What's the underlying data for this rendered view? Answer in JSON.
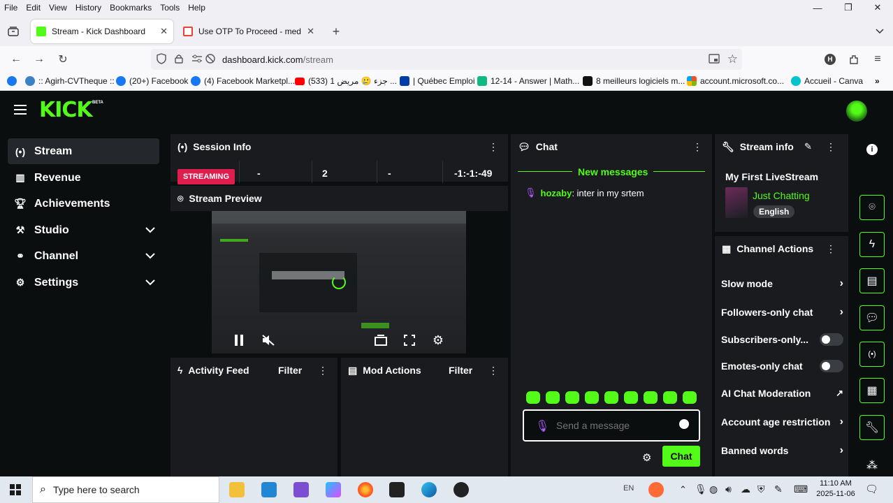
{
  "browser": {
    "menu": [
      "File",
      "Edit",
      "View",
      "History",
      "Bookmarks",
      "Tools",
      "Help"
    ],
    "window_controls": {
      "minimize": "—",
      "restore": "❐",
      "close": "✕"
    },
    "tabs": [
      {
        "title": "Stream - Kick Dashboard",
        "active": true,
        "favicon_color": "#53fc18"
      },
      {
        "title": "Use OTP To Proceed - medhbas",
        "active": false,
        "favicon_color": "#ea4335"
      }
    ],
    "new_tab": "+",
    "url_domain": "dashboard.kick.com",
    "url_path": "/stream",
    "bookmarks": [
      {
        "label": "",
        "color": "#1877f2"
      },
      {
        "label": ":: Agirh-CVTheque ::",
        "color": "#3b82c4"
      },
      {
        "label": "(20+) Facebook",
        "color": "#1877f2"
      },
      {
        "label": "(4) Facebook Marketpl...",
        "color": "#1877f2"
      },
      {
        "label": "(533) 1 جزء 🥲 مريض ...",
        "color": "#ff0000"
      },
      {
        "label": "| Québec Emploi",
        "color": "#003da5"
      },
      {
        "label": "12-14 - Answer | Math...",
        "color": "#10b981"
      },
      {
        "label": "8 meilleurs logiciels m...",
        "color": "#111111"
      },
      {
        "label": "account.microsoft.co...",
        "color": "#f25022"
      },
      {
        "label": "Accueil - Canva",
        "color": "#00c4cc"
      }
    ]
  },
  "kick": {
    "logo": "KICK",
    "beta": "BETA",
    "accent": "#53fc18",
    "sidebar": [
      {
        "label": "Stream",
        "icon": "broadcast-icon",
        "active": true,
        "chevron": false
      },
      {
        "label": "Revenue",
        "icon": "chart-icon",
        "active": false,
        "chevron": false
      },
      {
        "label": "Achievements",
        "icon": "trophy-icon",
        "active": false,
        "chevron": false
      },
      {
        "label": "Studio",
        "icon": "studio-icon",
        "active": false,
        "chevron": true
      },
      {
        "label": "Channel",
        "icon": "channel-icon",
        "active": false,
        "chevron": true
      },
      {
        "label": "Settings",
        "icon": "gear-icon",
        "active": false,
        "chevron": true
      }
    ],
    "session": {
      "title": "Session Info",
      "status": "STREAMING",
      "cells": [
        "-",
        "2",
        "-",
        "-1:-1:-49"
      ]
    },
    "preview": {
      "title": "Stream Preview"
    },
    "activity": {
      "title": "Activity Feed",
      "filter": "Filter"
    },
    "mod": {
      "title": "Mod Actions",
      "filter": "Filter"
    },
    "chat": {
      "title": "Chat",
      "new_messages": "New messages",
      "messages": [
        {
          "user": "hozaby",
          "text": ": inter in my srtem"
        }
      ],
      "placeholder": "Send a message",
      "send": "Chat"
    },
    "stream_info": {
      "title": "Stream info",
      "stream_title": "My First LiveStream",
      "category": "Just Chatting",
      "language": "English"
    },
    "channel_actions": {
      "title": "Channel Actions",
      "items": [
        {
          "label": "Slow mode",
          "control": "arrow"
        },
        {
          "label": "Followers-only chat",
          "control": "arrow"
        },
        {
          "label": "Subscribers-only...",
          "control": "toggle"
        },
        {
          "label": "Emotes-only chat",
          "control": "toggle"
        },
        {
          "label": "AI Chat Moderation",
          "control": "external"
        },
        {
          "label": "Account age restriction",
          "control": "arrow"
        },
        {
          "label": "Banned words",
          "control": "arrow"
        }
      ]
    }
  },
  "taskbar": {
    "search_placeholder": "Type here to search",
    "time": "11:10 AM",
    "date": "2025-11-06",
    "lang": "EN"
  }
}
